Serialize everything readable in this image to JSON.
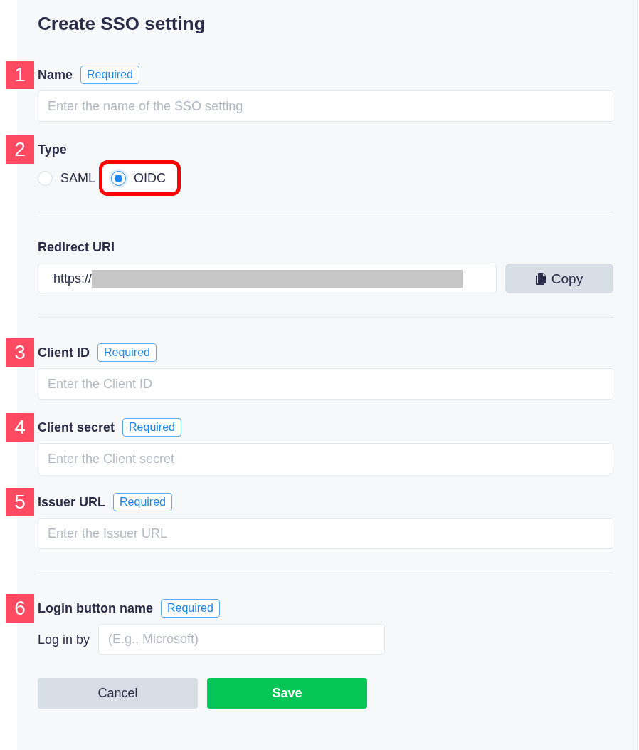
{
  "title": "Create SSO setting",
  "sections": [
    {
      "fields": [
        {
          "kind": "text",
          "marker": "1",
          "label": "Name",
          "badge": "Required",
          "placeholder": "Enter the name of the SSO setting"
        },
        {
          "kind": "radio",
          "marker": "2",
          "label": "Type",
          "options": [
            {
              "label": "SAML",
              "selected": false,
              "highlighted": false
            },
            {
              "label": "OIDC",
              "selected": true,
              "highlighted": true
            }
          ]
        }
      ]
    },
    {
      "fields": [
        {
          "kind": "copy",
          "label": "Redirect URI",
          "value": "https://",
          "button": "Copy"
        }
      ]
    },
    {
      "fields": [
        {
          "kind": "text",
          "marker": "3",
          "label": "Client ID",
          "badge": "Required",
          "placeholder": "Enter the Client ID"
        },
        {
          "kind": "text",
          "marker": "4",
          "label": "Client secret",
          "badge": "Required",
          "placeholder": "Enter the Client secret"
        },
        {
          "kind": "text",
          "marker": "5",
          "label": "Issuer URL",
          "badge": "Required",
          "placeholder": "Enter the Issuer URL"
        }
      ]
    },
    {
      "fields": [
        {
          "kind": "prefixed",
          "marker": "6",
          "label": "Login button name",
          "badge": "Required",
          "prefix": "Log in by",
          "placeholder": "(E.g., Microsoft)"
        }
      ]
    }
  ],
  "buttons": [
    {
      "kind": "secondary",
      "label": "Cancel"
    },
    {
      "kind": "primary",
      "label": "Save"
    }
  ]
}
